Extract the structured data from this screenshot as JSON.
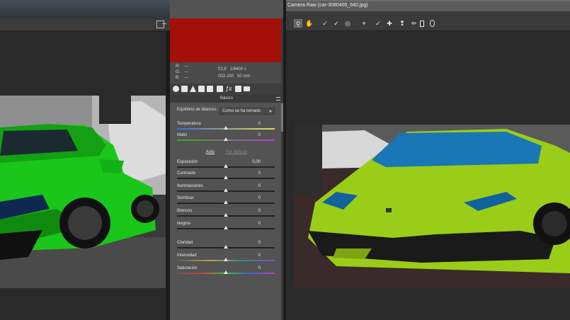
{
  "right_window": {
    "title": "Camera Raw (car-3080405_640.jpg)"
  },
  "toolbar": {
    "tools": [
      "zoom-tool",
      "hand-tool",
      "white-balance-tool",
      "color-sampler-tool",
      "targeted-adjustment-tool",
      "crop-tool",
      "straighten-tool",
      "spot-removal-tool",
      "red-eye-removal-tool",
      "adjustment-brush-tool",
      "graduated-filter-tool",
      "radial-filter-tool"
    ]
  },
  "colors": {
    "sampled_swatch": "#a41007",
    "panel_bg": "#535353",
    "left_car": "#19c619",
    "right_car": "#9acd18"
  },
  "readout": {
    "r_label": "R:",
    "g_label": "G:",
    "b_label": "B:",
    "r_value": "---",
    "g_value": "---",
    "b_value": "---",
    "aperture_shutter": "f/2,8   1/6400 s",
    "iso_focal": "ISO 200   50 mm"
  },
  "panel": {
    "title": "Básico",
    "white_balance_label": "Equilibrio de blancos:",
    "white_balance_value": "Como se ha tomado",
    "auto_label": "Auto",
    "default_label": "Por defecto",
    "sliders": [
      {
        "label": "Temperatura",
        "value": "0"
      },
      {
        "label": "Matiz",
        "value": "0"
      },
      {
        "label": "Exposición",
        "value": "0,00"
      },
      {
        "label": "Contraste",
        "value": "0"
      },
      {
        "label": "Iluminaciones",
        "value": "0"
      },
      {
        "label": "Sombras",
        "value": "0"
      },
      {
        "label": "Blancos",
        "value": "0"
      },
      {
        "label": "Negros",
        "value": "0"
      },
      {
        "label": "Claridad",
        "value": "0"
      },
      {
        "label": "Intensidad",
        "value": "0"
      },
      {
        "label": "Saturación",
        "value": "0"
      }
    ]
  }
}
